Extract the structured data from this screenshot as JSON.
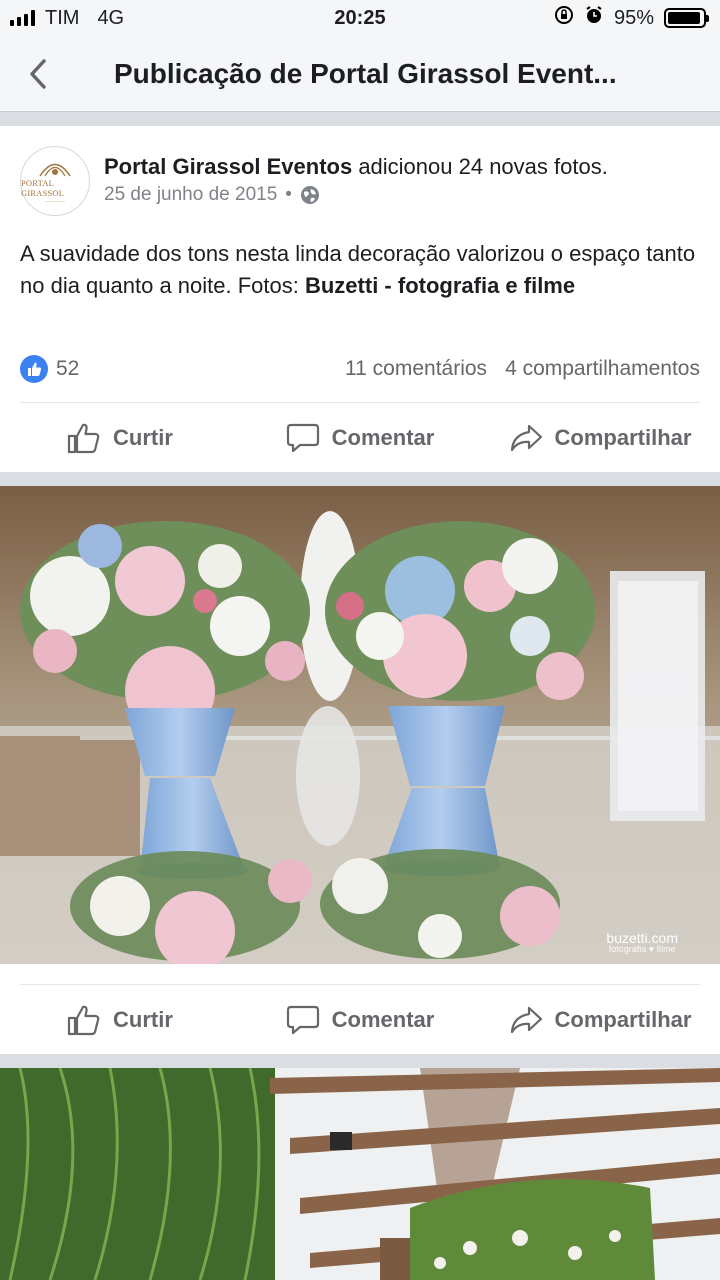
{
  "status_bar": {
    "carrier": "TIM",
    "network": "4G",
    "time": "20:25",
    "battery_percent": "95%",
    "battery_level": 0.95
  },
  "header": {
    "title": "Publicação de Portal Girassol Event..."
  },
  "post": {
    "page_name": "Portal Girassol Eventos",
    "action_text": " adicionou 24 novas fotos.",
    "date": "25 de junho de 2015",
    "separator": "•",
    "avatar_logo_text": "PORTAL GIRASSOL",
    "text_plain": "A suavidade dos tons nesta linda decoração valorizou o espaço tanto no dia quanto a noite. Fotos: ",
    "text_bold": "Buzetti - fotografia e filme",
    "likes": "52",
    "comments": "11 comentários",
    "shares": "4 compartilhamentos"
  },
  "actions": {
    "like": "Curtir",
    "comment": "Comentar",
    "share": "Compartilhar"
  },
  "photo": {
    "watermark_main": "buzetti.com",
    "watermark_sub": "fotografia ♥ filme"
  },
  "colors": {
    "like_blue": "#3b82f0",
    "action_gray": "#65676b",
    "background": "#dadde1"
  }
}
